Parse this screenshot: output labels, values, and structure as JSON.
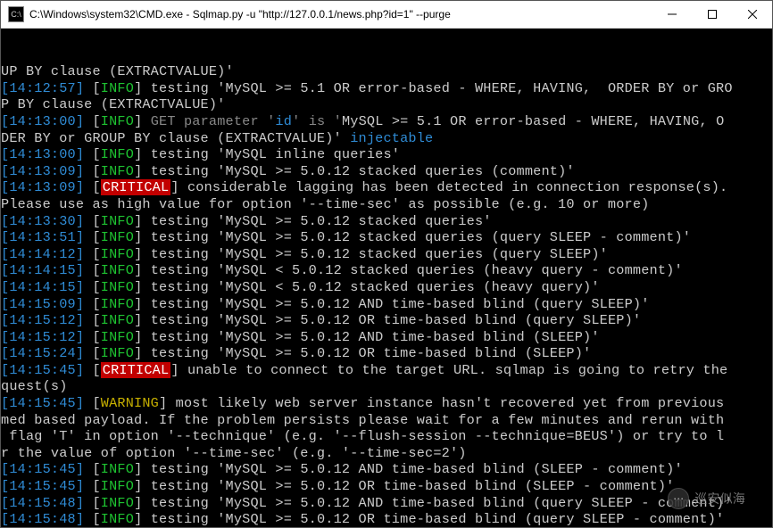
{
  "window": {
    "title": "C:\\Windows\\system32\\CMD.exe - Sqlmap.py  -u \"http://127.0.0.1/news.php?id=1\" --purge"
  },
  "watermark": "巡安似海",
  "lines": [
    {
      "parts": [
        {
          "t": "UP BY clause (EXTRACTVALUE)'"
        }
      ]
    },
    {
      "parts": [
        {
          "c": "ts",
          "t": "[14:12:57]"
        },
        {
          "t": " "
        },
        {
          "c": "b",
          "t": "["
        },
        {
          "c": "inf",
          "t": "INFO"
        },
        {
          "c": "b",
          "t": "]"
        },
        {
          "t": " testing 'MySQL >= 5.1 OR error-based - WHERE, HAVING,  ORDER BY or GRO"
        }
      ]
    },
    {
      "parts": [
        {
          "t": "P BY clause (EXTRACTVALUE)'"
        }
      ]
    },
    {
      "parts": [
        {
          "c": "ts",
          "t": "[14:13:00]"
        },
        {
          "t": " "
        },
        {
          "c": "b",
          "t": "["
        },
        {
          "c": "inf",
          "t": "INFO"
        },
        {
          "c": "b",
          "t": "]"
        },
        {
          "c": "gray",
          "t": " GET parameter '"
        },
        {
          "c": "kw",
          "t": "id"
        },
        {
          "c": "gray",
          "t": "' is '"
        },
        {
          "t": "MySQL >= 5.1 OR error-based - WHERE, HAVING, O"
        }
      ]
    },
    {
      "parts": [
        {
          "t": "DER BY or GROUP BY clause (EXTRACTVALUE)'"
        },
        {
          "c": "kw",
          "t": " injectable"
        }
      ]
    },
    {
      "parts": [
        {
          "c": "ts",
          "t": "[14:13:00]"
        },
        {
          "t": " "
        },
        {
          "c": "b",
          "t": "["
        },
        {
          "c": "inf",
          "t": "INFO"
        },
        {
          "c": "b",
          "t": "]"
        },
        {
          "t": " testing 'MySQL inline queries'"
        }
      ]
    },
    {
      "parts": [
        {
          "c": "ts",
          "t": "[14:13:09]"
        },
        {
          "t": " "
        },
        {
          "c": "b",
          "t": "["
        },
        {
          "c": "inf",
          "t": "INFO"
        },
        {
          "c": "b",
          "t": "]"
        },
        {
          "t": " testing 'MySQL >= 5.0.12 stacked queries (comment)'"
        }
      ]
    },
    {
      "parts": [
        {
          "c": "ts",
          "t": "[14:13:09]"
        },
        {
          "t": " "
        },
        {
          "c": "b",
          "t": "["
        },
        {
          "c": "crit",
          "t": "CRITICAL"
        },
        {
          "c": "b",
          "t": "]"
        },
        {
          "t": " considerable lagging has been detected in connection response(s). "
        }
      ]
    },
    {
      "parts": [
        {
          "t": "Please use as high value for option '--time-sec' as possible (e.g. 10 or more)"
        }
      ]
    },
    {
      "parts": [
        {
          "c": "ts",
          "t": "[14:13:30]"
        },
        {
          "t": " "
        },
        {
          "c": "b",
          "t": "["
        },
        {
          "c": "inf",
          "t": "INFO"
        },
        {
          "c": "b",
          "t": "]"
        },
        {
          "t": " testing 'MySQL >= 5.0.12 stacked queries'"
        }
      ]
    },
    {
      "parts": [
        {
          "c": "ts",
          "t": "[14:13:51]"
        },
        {
          "t": " "
        },
        {
          "c": "b",
          "t": "["
        },
        {
          "c": "inf",
          "t": "INFO"
        },
        {
          "c": "b",
          "t": "]"
        },
        {
          "t": " testing 'MySQL >= 5.0.12 stacked queries (query SLEEP - comment)'"
        }
      ]
    },
    {
      "parts": [
        {
          "c": "ts",
          "t": "[14:14:12]"
        },
        {
          "t": " "
        },
        {
          "c": "b",
          "t": "["
        },
        {
          "c": "inf",
          "t": "INFO"
        },
        {
          "c": "b",
          "t": "]"
        },
        {
          "t": " testing 'MySQL >= 5.0.12 stacked queries (query SLEEP)'"
        }
      ]
    },
    {
      "parts": [
        {
          "c": "ts",
          "t": "[14:14:15]"
        },
        {
          "t": " "
        },
        {
          "c": "b",
          "t": "["
        },
        {
          "c": "inf",
          "t": "INFO"
        },
        {
          "c": "b",
          "t": "]"
        },
        {
          "t": " testing 'MySQL < 5.0.12 stacked queries (heavy query - comment)'"
        }
      ]
    },
    {
      "parts": [
        {
          "c": "ts",
          "t": "[14:14:15]"
        },
        {
          "t": " "
        },
        {
          "c": "b",
          "t": "["
        },
        {
          "c": "inf",
          "t": "INFO"
        },
        {
          "c": "b",
          "t": "]"
        },
        {
          "t": " testing 'MySQL < 5.0.12 stacked queries (heavy query)'"
        }
      ]
    },
    {
      "parts": [
        {
          "c": "ts",
          "t": "[14:15:09]"
        },
        {
          "t": " "
        },
        {
          "c": "b",
          "t": "["
        },
        {
          "c": "inf",
          "t": "INFO"
        },
        {
          "c": "b",
          "t": "]"
        },
        {
          "t": " testing 'MySQL >= 5.0.12 AND time-based blind (query SLEEP)'"
        }
      ]
    },
    {
      "parts": [
        {
          "c": "ts",
          "t": "[14:15:12]"
        },
        {
          "t": " "
        },
        {
          "c": "b",
          "t": "["
        },
        {
          "c": "inf",
          "t": "INFO"
        },
        {
          "c": "b",
          "t": "]"
        },
        {
          "t": " testing 'MySQL >= 5.0.12 OR time-based blind (query SLEEP)'"
        }
      ]
    },
    {
      "parts": [
        {
          "c": "ts",
          "t": "[14:15:12]"
        },
        {
          "t": " "
        },
        {
          "c": "b",
          "t": "["
        },
        {
          "c": "inf",
          "t": "INFO"
        },
        {
          "c": "b",
          "t": "]"
        },
        {
          "t": " testing 'MySQL >= 5.0.12 AND time-based blind (SLEEP)'"
        }
      ]
    },
    {
      "parts": [
        {
          "c": "ts",
          "t": "[14:15:24]"
        },
        {
          "t": " "
        },
        {
          "c": "b",
          "t": "["
        },
        {
          "c": "inf",
          "t": "INFO"
        },
        {
          "c": "b",
          "t": "]"
        },
        {
          "t": " testing 'MySQL >= 5.0.12 OR time-based blind (SLEEP)'"
        }
      ]
    },
    {
      "parts": [
        {
          "c": "ts",
          "t": "[14:15:45]"
        },
        {
          "t": " "
        },
        {
          "c": "b",
          "t": "["
        },
        {
          "c": "crit",
          "t": "CRITICAL"
        },
        {
          "c": "b",
          "t": "]"
        },
        {
          "t": " unable to connect to the target URL. sqlmap is going to retry the "
        }
      ]
    },
    {
      "parts": [
        {
          "t": "quest(s)"
        }
      ]
    },
    {
      "parts": [
        {
          "c": "ts",
          "t": "[14:15:45]"
        },
        {
          "t": " "
        },
        {
          "c": "b",
          "t": "["
        },
        {
          "c": "wrn",
          "t": "WARNING"
        },
        {
          "c": "b",
          "t": "]"
        },
        {
          "t": " most likely web server instance hasn't recovered yet from previous "
        }
      ]
    },
    {
      "parts": [
        {
          "t": "med based payload. If the problem persists please wait for a few minutes and rerun with"
        }
      ]
    },
    {
      "parts": [
        {
          "t": " flag 'T' in option '--technique' (e.g. '--flush-session --technique=BEUS') or try to l"
        }
      ]
    },
    {
      "parts": [
        {
          "t": "r the value of option '--time-sec' (e.g. '--time-sec=2')"
        }
      ]
    },
    {
      "parts": [
        {
          "c": "ts",
          "t": "[14:15:45]"
        },
        {
          "t": " "
        },
        {
          "c": "b",
          "t": "["
        },
        {
          "c": "inf",
          "t": "INFO"
        },
        {
          "c": "b",
          "t": "]"
        },
        {
          "t": " testing 'MySQL >= 5.0.12 AND time-based blind (SLEEP - comment)'"
        }
      ]
    },
    {
      "parts": [
        {
          "c": "ts",
          "t": "[14:15:45]"
        },
        {
          "t": " "
        },
        {
          "c": "b",
          "t": "["
        },
        {
          "c": "inf",
          "t": "INFO"
        },
        {
          "c": "b",
          "t": "]"
        },
        {
          "t": " testing 'MySQL >= 5.0.12 OR time-based blind (SLEEP - comment)'"
        }
      ]
    },
    {
      "parts": [
        {
          "c": "ts",
          "t": "[14:15:48]"
        },
        {
          "t": " "
        },
        {
          "c": "b",
          "t": "["
        },
        {
          "c": "inf",
          "t": "INFO"
        },
        {
          "c": "b",
          "t": "]"
        },
        {
          "t": " testing 'MySQL >= 5.0.12 AND time-based blind (query SLEEP - comment)'"
        }
      ]
    },
    {
      "parts": [
        {
          "c": "ts",
          "t": "[14:15:48]"
        },
        {
          "t": " "
        },
        {
          "c": "b",
          "t": "["
        },
        {
          "c": "inf",
          "t": "INFO"
        },
        {
          "c": "b",
          "t": "]"
        },
        {
          "t": " testing 'MySQL >= 5.0.12 OR time-based blind (query SLEEP - comment)'"
        }
      ]
    }
  ]
}
